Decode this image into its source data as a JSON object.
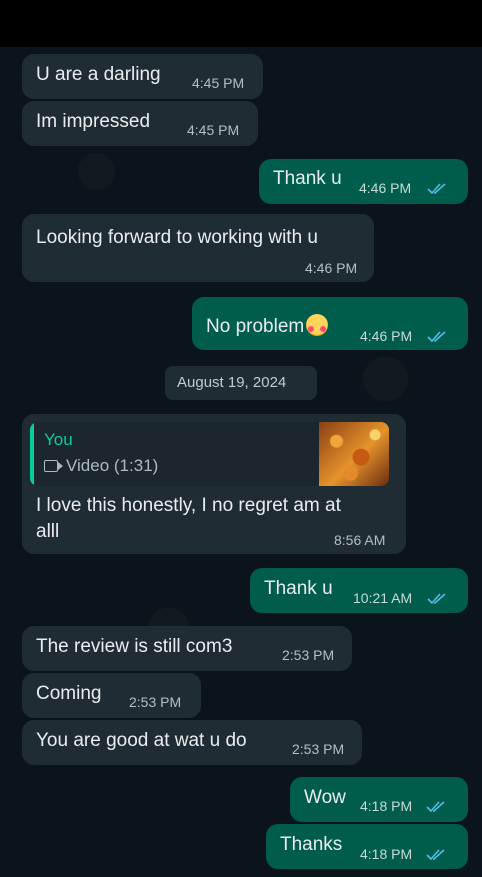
{
  "colors": {
    "incoming_bubble": "#202c33",
    "outgoing_bubble": "#005c4b",
    "read_ticks": "#53bdeb",
    "reply_accent": "#06cf9c"
  },
  "messages": [
    {
      "text": "U are a darling",
      "time": "4:45 PM"
    },
    {
      "text": "Im impressed",
      "time": "4:45 PM"
    },
    {
      "text": "Thank u",
      "time": "4:46 PM",
      "status": "read"
    },
    {
      "text": "Looking forward to working with u",
      "time": "4:46 PM"
    },
    {
      "text": "No problem",
      "emoji": "smiling-face-with-hearts",
      "time": "4:46 PM",
      "status": "read"
    },
    {
      "text": "I love this honestly, I no regret am at",
      "text2": "alll",
      "time": "8:56 AM",
      "reply": {
        "name": "You",
        "label": "Video (1:31)",
        "icon": "video-icon"
      }
    },
    {
      "text": "Thank u",
      "time": "10:21 AM",
      "status": "read"
    },
    {
      "text": "The review is still com3",
      "time": "2:53 PM"
    },
    {
      "text": "Coming",
      "time": "2:53 PM"
    },
    {
      "text": "You are good at wat u do",
      "time": "2:53 PM"
    },
    {
      "text": "Wow",
      "time": "4:18 PM",
      "status": "read"
    },
    {
      "text": "Thanks",
      "time": "4:18 PM",
      "status": "read"
    }
  ],
  "date_divider": "August 19, 2024"
}
